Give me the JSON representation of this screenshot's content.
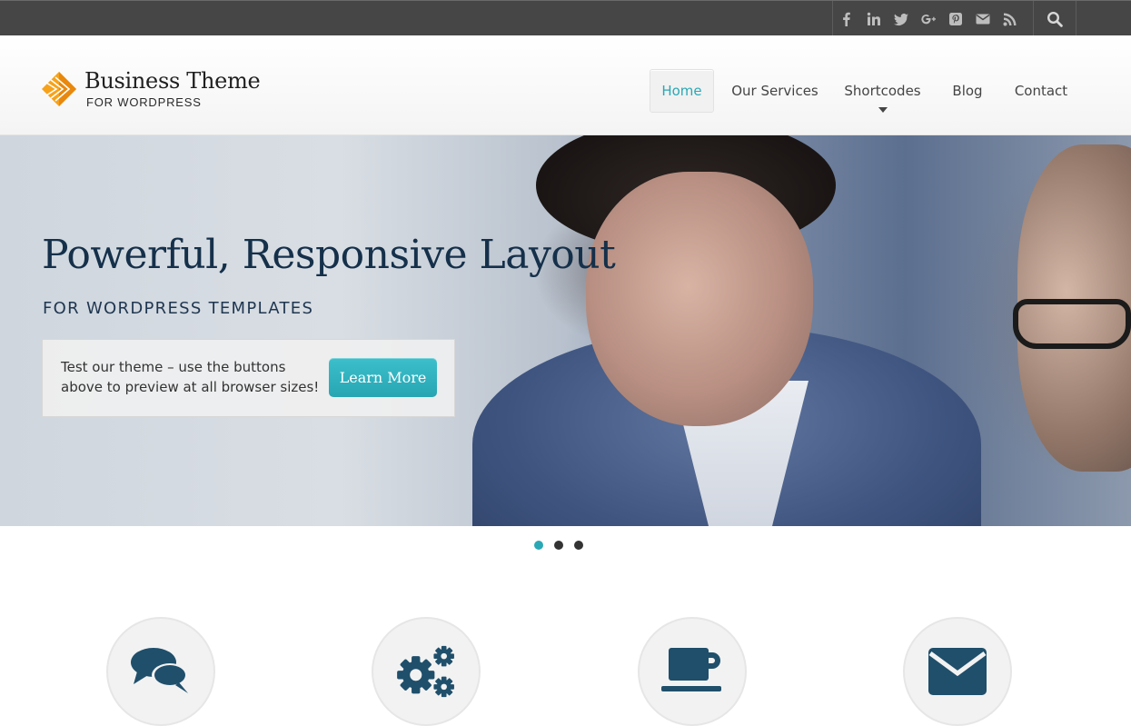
{
  "topbar": {
    "social_icons": [
      "facebook-icon",
      "linkedin-icon",
      "twitter-icon",
      "google-plus-icon",
      "pinterest-icon",
      "email-icon",
      "rss-icon"
    ],
    "search_icon": "search-icon"
  },
  "brand": {
    "title": "Business Theme",
    "subtitle": "FOR WORDPRESS",
    "accent": "#f59d1a"
  },
  "nav": {
    "items": [
      {
        "label": "Home",
        "active": true
      },
      {
        "label": "Our Services",
        "active": false
      },
      {
        "label": "Shortcodes",
        "active": false,
        "has_dropdown": true
      },
      {
        "label": "Blog",
        "active": false
      },
      {
        "label": "Contact",
        "active": false
      }
    ]
  },
  "hero": {
    "title": "Powerful, Responsive Layout",
    "subtitle": "FOR WORDPRESS TEMPLATES",
    "box_text": "Test our theme – use the buttons above to preview at all browser sizes!",
    "button_label": "Learn More"
  },
  "slider": {
    "slide_count": 3,
    "active_index": 0
  },
  "features": {
    "icons": [
      "chat-bubbles-icon",
      "gears-icon",
      "coffee-cup-icon",
      "envelope-icon"
    ]
  },
  "colors": {
    "accent": "#2aa8b5",
    "topbar": "#464646",
    "icon": "#1f4f6b",
    "heading": "#15304a"
  }
}
